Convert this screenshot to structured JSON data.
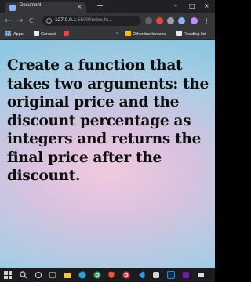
{
  "browser": {
    "tab_title": "Document",
    "tab_close": "×",
    "new_tab": "+",
    "url_host": "127.0.0.1",
    "url_rest": ":5500/index.ht...",
    "nav": {
      "back": "←",
      "forward": "→",
      "reload": "C"
    }
  },
  "bookmarks": {
    "apps": "Apps",
    "contact": "Contact",
    "other": "Other bookmarks",
    "reading_list": "Reading list"
  },
  "window_controls": {
    "minimize": "–",
    "maximize": "□",
    "close": "×"
  },
  "page": {
    "question_lines": [
      "Create a function that",
      "takes two arguments: the",
      "original price and the",
      "discount percentage as",
      "integers and returns the",
      "final price after the",
      "discount."
    ]
  },
  "colors": {
    "tab_strip": "#202124",
    "toolbar": "#35363a",
    "page_bg_center": "#f2c9df",
    "page_bg_edge": "#8ec7e2"
  }
}
